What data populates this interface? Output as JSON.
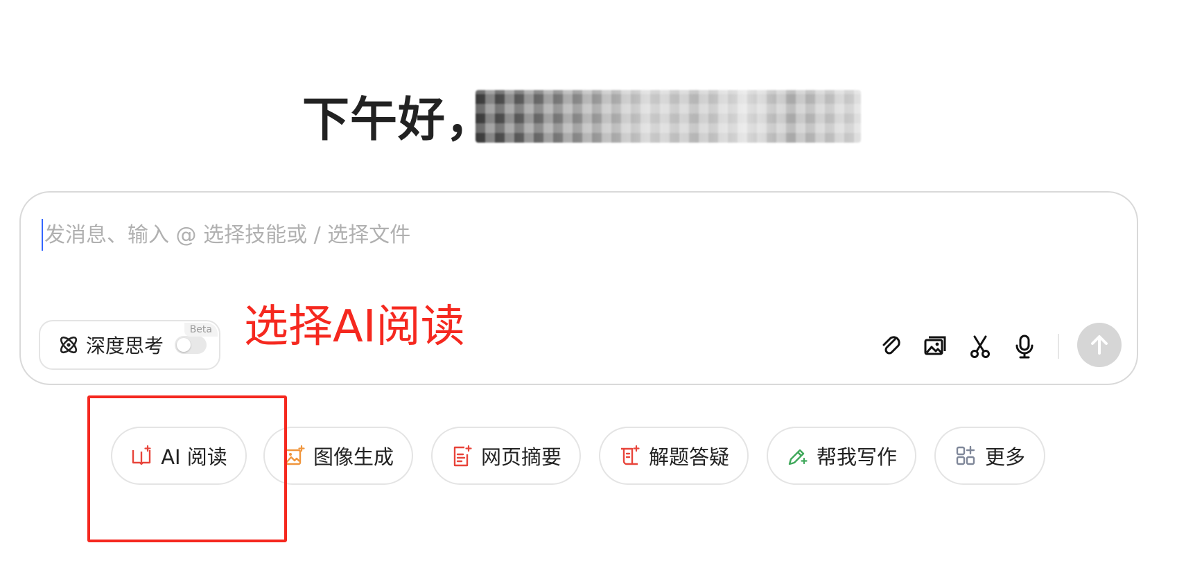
{
  "greeting": {
    "text": "下午好，",
    "username_redacted": true
  },
  "composer": {
    "placeholder": "发消息、输入 @ 选择技能或 / 选择文件",
    "value": "",
    "deep_think": {
      "label": "深度思考",
      "badge": "Beta",
      "enabled": false,
      "icon": "atom-icon"
    },
    "tools": [
      {
        "name": "attach",
        "icon": "paperclip-icon"
      },
      {
        "name": "image",
        "icon": "image-upload-icon"
      },
      {
        "name": "scissors",
        "icon": "scissors-icon"
      },
      {
        "name": "voice",
        "icon": "microphone-icon"
      }
    ],
    "send_icon": "arrow-up-icon"
  },
  "annotation": {
    "text": "选择AI阅读",
    "color": "#f5281f"
  },
  "skills": [
    {
      "label": "AI 阅读",
      "icon": "book-sparkle-icon",
      "color": "#e8443a"
    },
    {
      "label": "图像生成",
      "icon": "image-sparkle-icon",
      "color": "#f0953b"
    },
    {
      "label": "网页摘要",
      "icon": "document-sparkle-icon",
      "color": "#e8443a"
    },
    {
      "label": "解题答疑",
      "icon": "scroll-sparkle-icon",
      "color": "#e8443a"
    },
    {
      "label": "帮我写作",
      "icon": "pencil-sparkle-icon",
      "color": "#3fa85a"
    },
    {
      "label": "更多",
      "icon": "apps-grid-icon",
      "color": "#7f8799"
    }
  ]
}
